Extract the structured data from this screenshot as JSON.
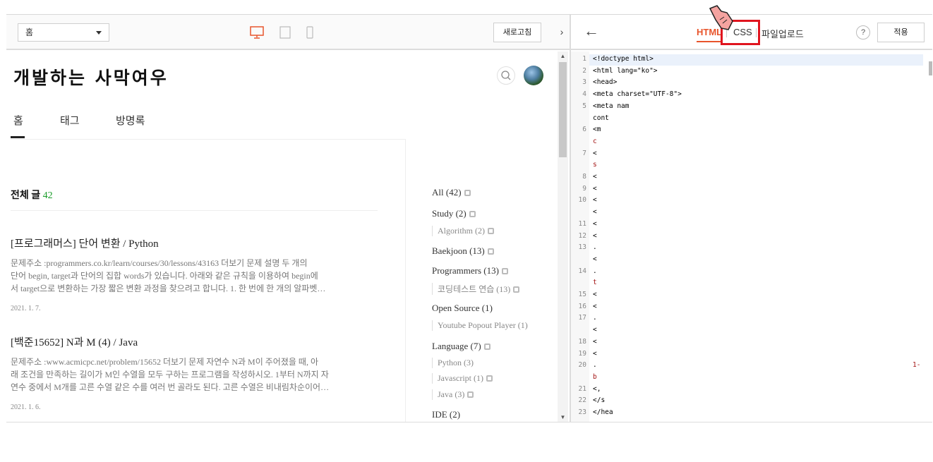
{
  "preview_toolbar": {
    "page_select": "홈",
    "refresh_label": "새로고침",
    "collapse_glyph": "›"
  },
  "blog": {
    "title": "개발하는 사막여우",
    "nav": [
      "홈",
      "태그",
      "방명록"
    ],
    "total_label": "전체 글",
    "total_count": "42",
    "posts": [
      {
        "title": "[프로그래머스] 단어 변환 / Python",
        "excerpt_lines": [
          "문제주소 :programmers.co.kr/learn/courses/30/lessons/43163 더보기 문제 설명 두 개의",
          "단어 begin, target과 단어의 집합 words가 있습니다. 아래와 같은 규칙을 이용하여 begin에",
          "서 target으로 변환하는 가장 짧은 변환 과정을 찾으려고 합니다. 1. 한 번에 한 개의 알파벳…"
        ],
        "date": "2021. 1. 7."
      },
      {
        "title": "[백준15652] N과 M (4) / Java",
        "excerpt_lines": [
          "문제주소 :www.acmicpc.net/problem/15652 더보기 문제 자연수 N과 M이 주어졌을 때, 아",
          "래 조건을 만족하는 길이가 M인 수열을 모두 구하는 프로그램을 작성하시오. 1부터 N까지 자",
          "연수 중에서 M개를 고른 수열 같은 수를 여러 번 골라도 된다. 고른 수열은 비내림차순이어…"
        ],
        "date": "2021. 1. 6."
      }
    ],
    "categories": [
      {
        "label": "All (42)",
        "new": true,
        "sub": false
      },
      {
        "label": "Study (2)",
        "new": true,
        "sub": false
      },
      {
        "label": "Algorithm (2)",
        "new": true,
        "sub": true
      },
      {
        "label": "Baekjoon (13)",
        "new": true,
        "sub": false
      },
      {
        "label": "Programmers (13)",
        "new": true,
        "sub": false
      },
      {
        "label": "코딩테스트 연습 (13)",
        "new": true,
        "sub": true
      },
      {
        "label": "Open Source (1)",
        "new": false,
        "sub": false
      },
      {
        "label": "Youtube Popout Player (1)",
        "new": false,
        "sub": true
      },
      {
        "label": "Language (7)",
        "new": true,
        "sub": false
      },
      {
        "label": "Python (3)",
        "new": false,
        "sub": true
      },
      {
        "label": "Javascript (1)",
        "new": true,
        "sub": true
      },
      {
        "label": "Java (3)",
        "new": true,
        "sub": true
      },
      {
        "label": "IDE (2)",
        "new": false,
        "sub": false
      }
    ]
  },
  "editor": {
    "back_glyph": "←",
    "tabs": {
      "html": "HTML",
      "css": "CSS",
      "upload": "파일업로드"
    },
    "help": "?",
    "apply": "적용",
    "line_numbers": [
      "1",
      "2",
      "3",
      "4",
      "5",
      "",
      "6",
      "",
      "7",
      "",
      "8",
      "9",
      "10",
      "",
      "11",
      "12",
      "13",
      "",
      "14",
      "",
      "15",
      "16",
      "17",
      "",
      "18",
      "19",
      "20",
      "",
      "21",
      "22",
      "23"
    ],
    "code_lines": [
      "<!doctype html>",
      "<html lang=\"ko\">",
      "<head>",
      "<meta charset=\"UTF-8\">",
      "<meta nam",
      "cont",
      "<m",
      "c",
      "<",
      "s",
      "<",
      "<",
      "<",
      "<",
      "<",
      "<",
      ".",
      "<",
      ".",
      "t",
      "<",
      "<",
      ".",
      "<",
      "<",
      "<",
      ".",
      "b",
      "<,",
      "</s",
      "</hea"
    ],
    "line20_tail": "1-"
  },
  "colors": {
    "accent": "#e8552c",
    "highlight": "#e0141e",
    "count_green": "#1a9c2a"
  }
}
